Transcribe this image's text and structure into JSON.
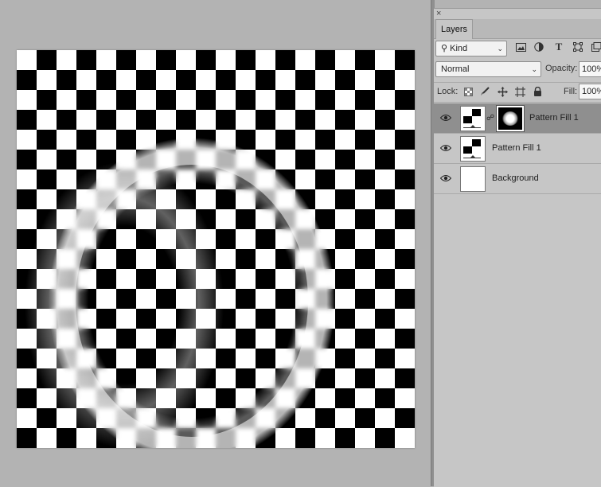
{
  "panel": {
    "close_glyph": "×",
    "tab_label": "Layers",
    "filter": {
      "icon": "search-icon",
      "value": "Kind"
    },
    "blend_mode": "Normal",
    "opacity_label": "Opacity:",
    "opacity_value": "100%",
    "lock_label": "Lock:",
    "fill_label": "Fill:",
    "fill_value": "100%",
    "filter_icons": [
      "image-filter-icon",
      "adjustment-filter-icon",
      "type-filter-icon",
      "shape-filter-icon",
      "smart-object-filter-icon"
    ],
    "lock_icons": [
      "lock-transparent-icon",
      "lock-image-icon",
      "lock-position-icon",
      "lock-artboard-icon",
      "lock-all-icon"
    ]
  },
  "layers": [
    {
      "name": "Pattern Fill 1",
      "selected": true,
      "has_mask": true
    },
    {
      "name": "Pattern Fill 1",
      "selected": false,
      "has_mask": false
    },
    {
      "name": "Background",
      "selected": false,
      "has_mask": false
    }
  ],
  "colors": {
    "workspace": "#b3b3b3",
    "panel": "#c6c6c6",
    "selected_layer": "#8f8f8f"
  }
}
